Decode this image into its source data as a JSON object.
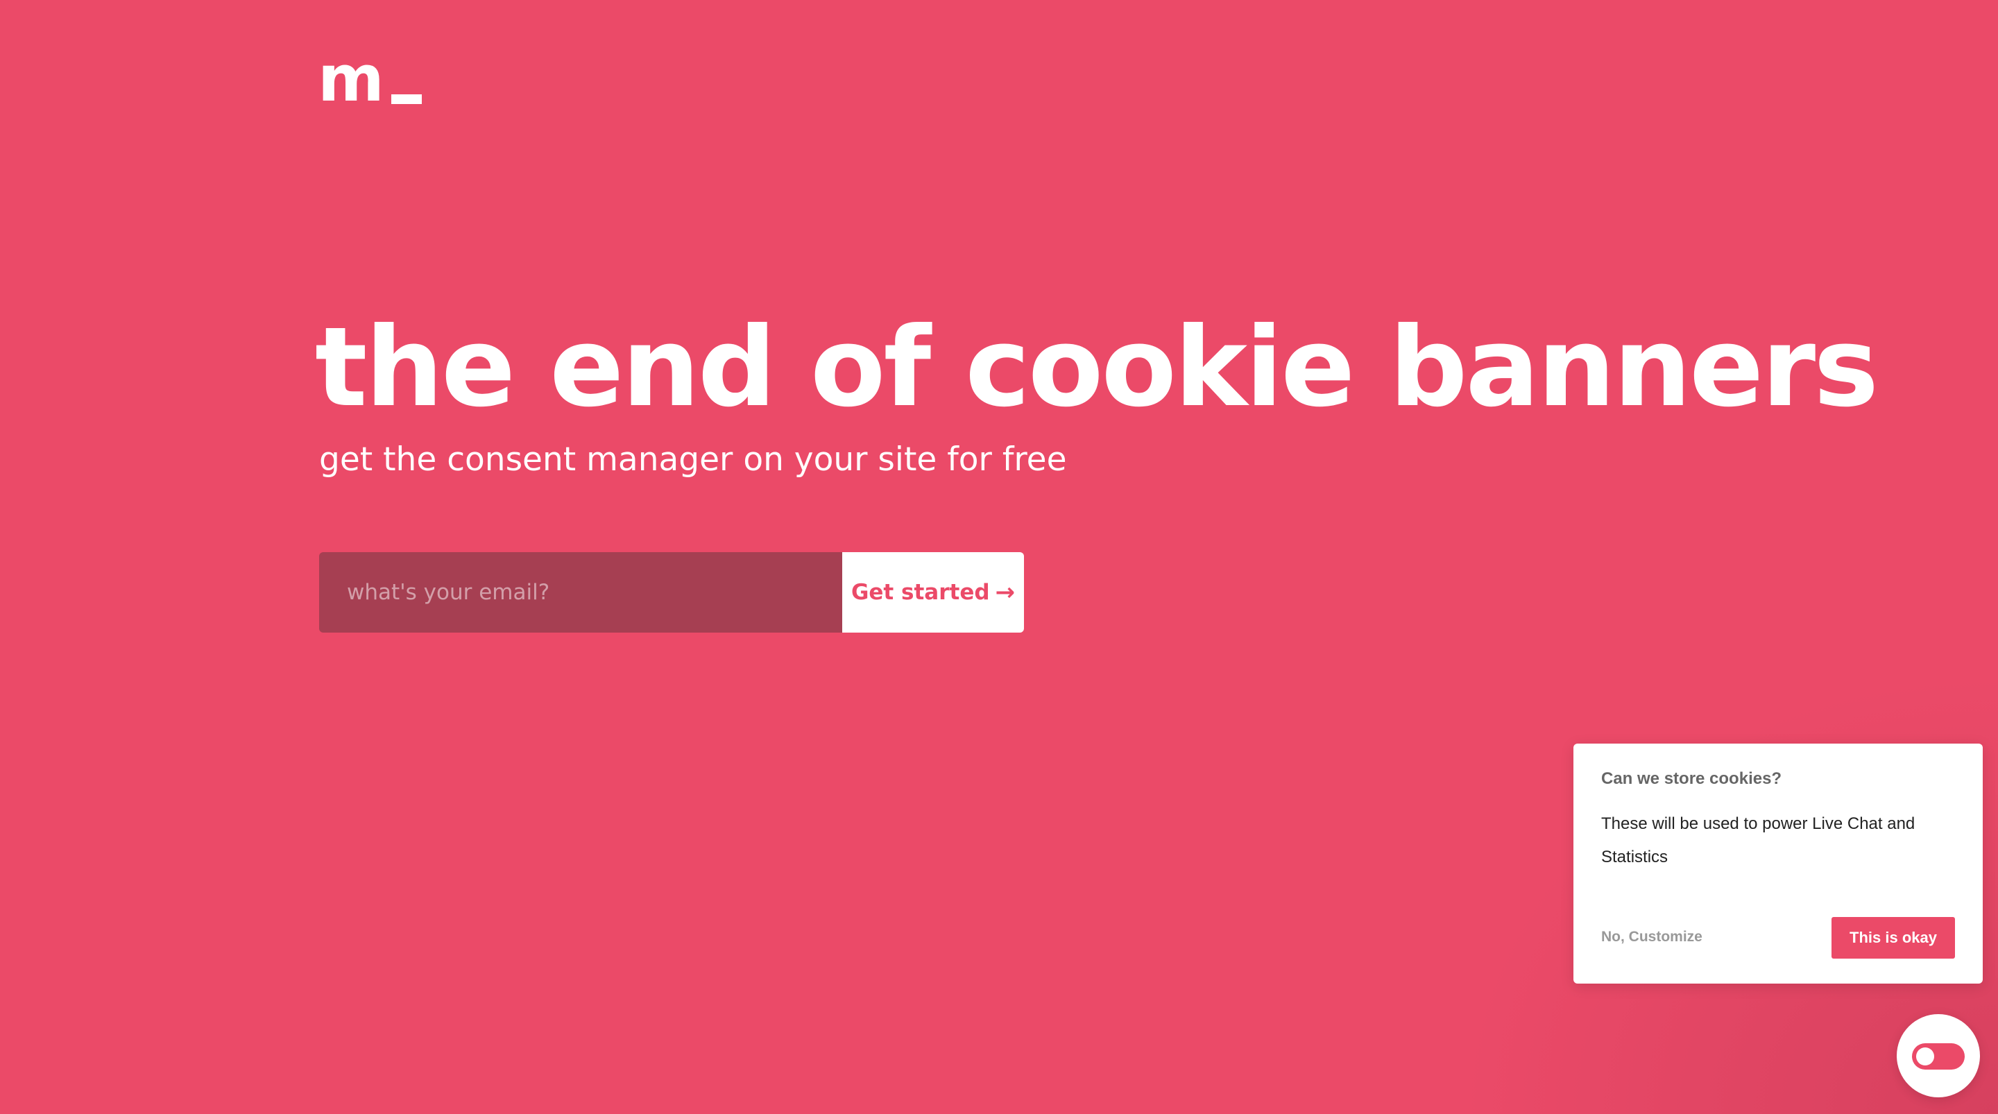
{
  "brand": {
    "logo_text": "m",
    "accent_color": "#eb4a68"
  },
  "hero": {
    "title": "the end of cookie banners",
    "subtitle": "get the consent manager on your site for free"
  },
  "signup": {
    "email_placeholder": "what's your email?",
    "email_value": "",
    "button_label": "Get started",
    "button_icon": "arrow-right-icon"
  },
  "consent": {
    "title": "Can we store cookies?",
    "text": "These will be used to power Live Chat and Statistics",
    "decline_label": "No, Customize",
    "accept_label": "This is okay"
  },
  "widget": {
    "icon": "toggle-icon"
  }
}
